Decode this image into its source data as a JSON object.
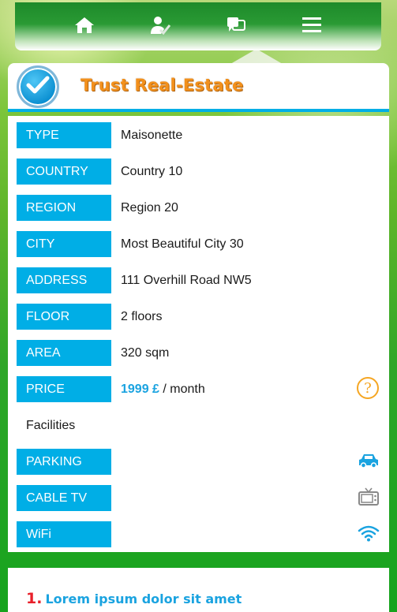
{
  "nav": {
    "items": [
      {
        "icon": "home-icon"
      },
      {
        "icon": "user-check-icon"
      },
      {
        "icon": "chat-icon"
      },
      {
        "icon": "menu-icon"
      }
    ]
  },
  "header": {
    "title": "Trust Real-Estate",
    "logo_icon": "checkmark-icon"
  },
  "details": {
    "rows": [
      {
        "label": "TYPE",
        "value": "Maisonette"
      },
      {
        "label": "COUNTRY",
        "value": "Country 10"
      },
      {
        "label": "REGION",
        "value": "Region 20"
      },
      {
        "label": "CITY",
        "value": "Most Beautiful City 30"
      },
      {
        "label": "ADDRESS",
        "value": "111 Overhill Road NW5"
      },
      {
        "label": "FLOOR",
        "value": "2 floors"
      },
      {
        "label": "AREA",
        "value": "320 sqm"
      }
    ],
    "price": {
      "label": "PRICE",
      "amount": "1999 £",
      "suffix": " / month",
      "icon": "question-icon"
    },
    "facilities_label": "Facilities",
    "facilities": [
      {
        "label": "PARKING",
        "icon": "car-icon"
      },
      {
        "label": "CABLE TV",
        "icon": "tv-icon"
      },
      {
        "label": "WiFi",
        "icon": "wifi-icon"
      }
    ]
  },
  "list": {
    "items": [
      {
        "number": "1.",
        "text": "Lorem ipsum dolor sit amet"
      }
    ]
  },
  "colors": {
    "accent": "#00aee6",
    "brand_orange": "#f2901c",
    "number_red": "#e8202a",
    "price_blue": "#1aa3e0"
  }
}
